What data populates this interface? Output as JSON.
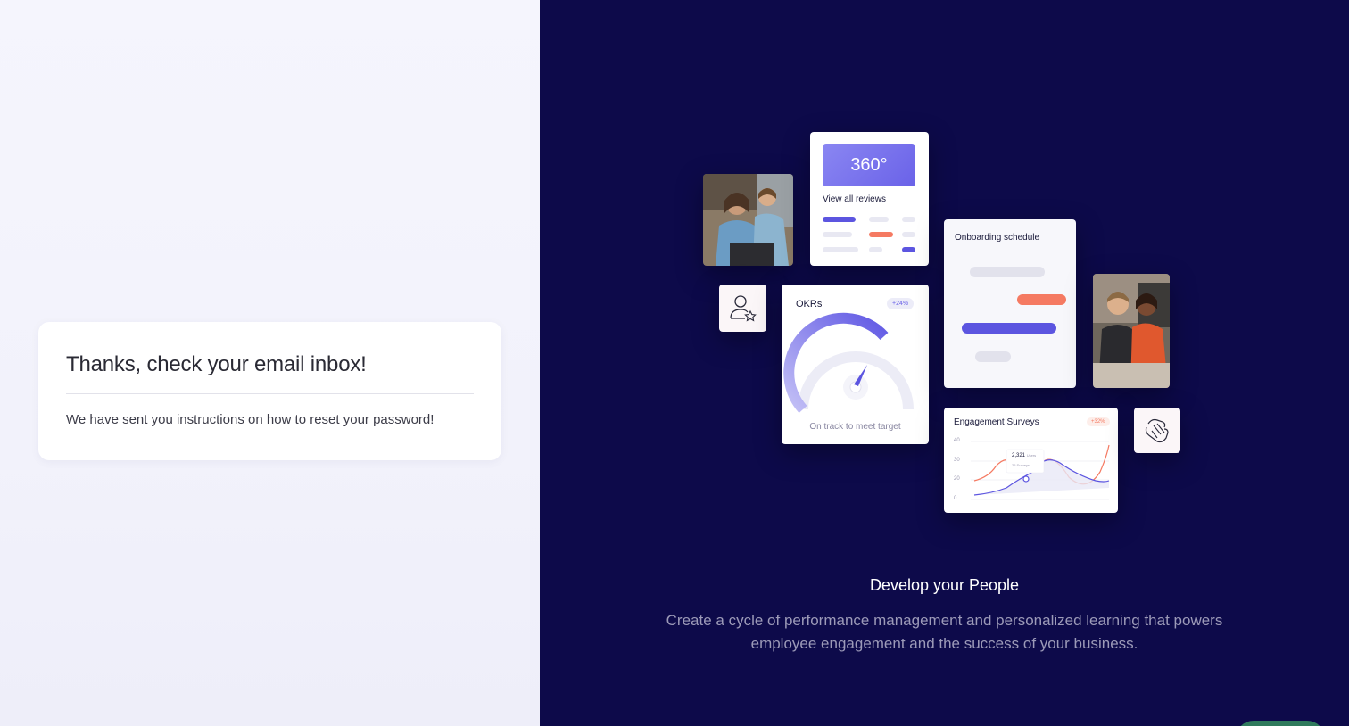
{
  "confirmation": {
    "title": "Thanks, check your email inbox!",
    "message": "We have sent you instructions on how to reset your password!"
  },
  "illustration": {
    "reviews_card": {
      "badge": "360°",
      "link_label": "View all reviews"
    },
    "onboarding_card": {
      "title": "Onboarding schedule"
    },
    "okrs_card": {
      "title": "OKRs",
      "pill": "+24%",
      "caption": "On track to meet target"
    },
    "engagement_card": {
      "title": "Engagement Surveys",
      "pill": "+32%",
      "y_ticks": [
        "40",
        "30",
        "20",
        "0"
      ],
      "tooltip_value": "2,321",
      "tooltip_value_suffix": "Users",
      "tooltip_sub": "25 Surveys"
    }
  },
  "promo": {
    "headline": "Develop your People",
    "description": "Create a cycle of performance management and personalized learning that powers employee engagement and the success of your business."
  },
  "colors": {
    "panel_dark": "#0d0a4a",
    "accent_purple": "#6a62e8",
    "accent_coral": "#f57a62"
  }
}
